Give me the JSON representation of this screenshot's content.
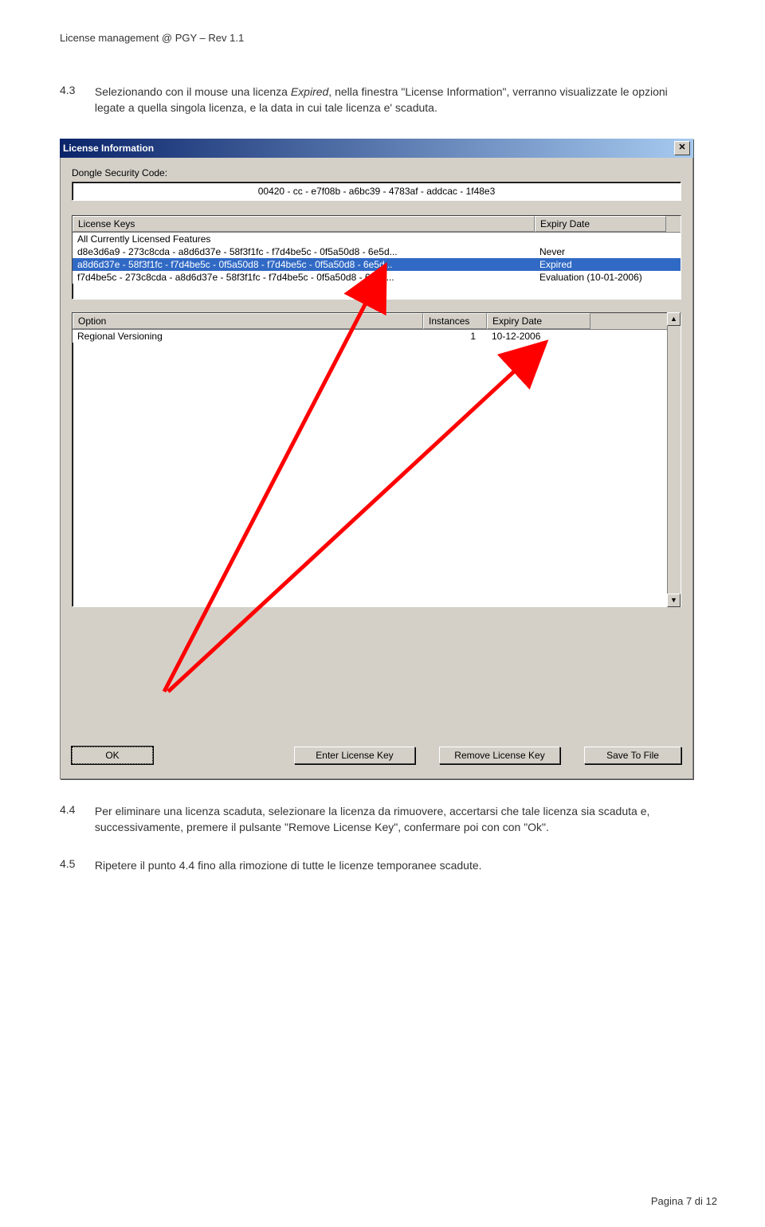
{
  "header": "License management @ PGY – Rev 1.1",
  "section43": {
    "num": "4.3",
    "pre": "Selezionando con il mouse una licenza ",
    "italic": "Expired",
    "post": ", nella finestra \"License Information\", verranno visualizzate le opzioni legate a quella singola licenza, e la data in cui tale licenza e' scaduta."
  },
  "dialog": {
    "title": "License Information",
    "dongle_label": "Dongle Security Code:",
    "dongle_value": "00420 - cc - e7f08b - a6bc39 - 4783af - addcac - 1f48e3",
    "keys_hdr": {
      "c1": "License Keys",
      "c2": "Expiry Date"
    },
    "keys_subhdr": "All Currently Licensed Features",
    "keys_rows": [
      {
        "key": "d8e3d6a9 - 273c8cda - a8d6d37e - 58f3f1fc - f7d4be5c - 0f5a50d8 - 6e5d...",
        "exp": "Never",
        "sel": false
      },
      {
        "key": "a8d6d37e - 58f3f1fc - f7d4be5c - 0f5a50d8 - f7d4be5c - 0f5a50d8 - 6e5d...",
        "exp": "Expired",
        "sel": true
      },
      {
        "key": "f7d4be5c - 273c8cda - a8d6d37e - 58f3f1fc - f7d4be5c - 0f5a50d8 - 6e5d...",
        "exp": "Evaluation (10-01-2006)",
        "sel": false
      }
    ],
    "opts_hdr": {
      "c1": "Option",
      "c2": "Instances",
      "c3": "Expiry Date"
    },
    "opts_rows": [
      {
        "opt": "Regional Versioning",
        "inst": "1",
        "exp": "10-12-2006"
      }
    ],
    "buttons": {
      "ok": "OK",
      "enter": "Enter License Key",
      "remove": "Remove License Key",
      "save": "Save To File"
    }
  },
  "section44": {
    "num": "4.4",
    "text": "Per eliminare una licenza scaduta, selezionare la licenza da rimuovere, accertarsi che tale licenza sia scaduta e, successivamente, premere il pulsante \"Remove License Key\", confermare poi con con \"Ok\"."
  },
  "section45": {
    "num": "4.5",
    "text": "Ripetere il punto 4.4 fino alla rimozione di tutte le licenze temporanee scadute."
  },
  "footer": "Pagina 7 di 12"
}
